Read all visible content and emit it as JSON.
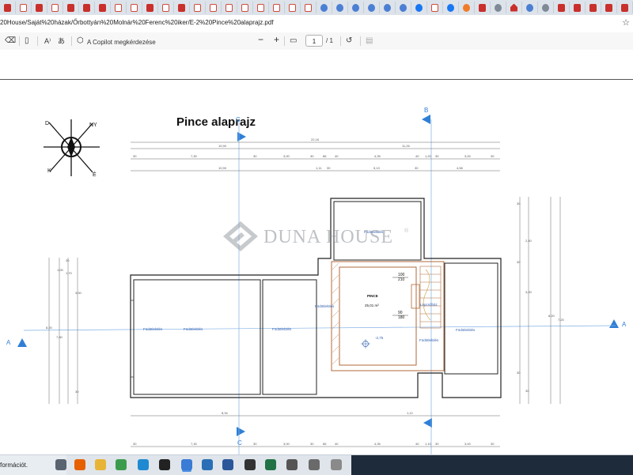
{
  "browser": {
    "tabs": [
      {
        "icon": "pdf-icon"
      },
      {
        "icon": "mail-icon"
      },
      {
        "icon": "pdf-icon"
      },
      {
        "icon": "mail-icon"
      },
      {
        "icon": "pdf-icon"
      },
      {
        "icon": "pdf-icon"
      },
      {
        "icon": "pdf-icon"
      },
      {
        "icon": "mail-icon"
      },
      {
        "icon": "mail-icon"
      },
      {
        "icon": "pdf-icon"
      },
      {
        "icon": "mail-icon"
      },
      {
        "icon": "pdf-icon"
      },
      {
        "icon": "mail-icon"
      },
      {
        "icon": "mail-icon"
      },
      {
        "icon": "mail-icon"
      },
      {
        "icon": "mail-icon"
      },
      {
        "icon": "mail-icon"
      },
      {
        "icon": "mail-icon"
      },
      {
        "icon": "mail-icon"
      },
      {
        "icon": "mail-icon"
      },
      {
        "icon": "search-icon"
      },
      {
        "icon": "search-icon"
      },
      {
        "icon": "search-icon"
      },
      {
        "icon": "search-icon"
      },
      {
        "icon": "search-icon"
      },
      {
        "icon": "search-icon"
      },
      {
        "icon": "facebook-icon"
      },
      {
        "icon": "mail-icon"
      },
      {
        "icon": "facebook-icon"
      },
      {
        "icon": "orange-circle-icon"
      },
      {
        "icon": "pdf-icon"
      },
      {
        "icon": "globe-icon"
      },
      {
        "icon": "home-icon"
      },
      {
        "icon": "search-icon"
      },
      {
        "icon": "help-icon"
      },
      {
        "icon": "pdf-icon"
      },
      {
        "icon": "pdf-icon"
      },
      {
        "icon": "pdf-icon"
      },
      {
        "icon": "pdf-icon"
      },
      {
        "icon": "pdf-icon"
      }
    ],
    "url": "20House/Saját%20házak/Őrbottyán%20Molnár%20Ferenc%20iker/E-2%20Pince%20alaprajz.pdf"
  },
  "pdf_toolbar": {
    "copilot_label": "A Copilot megkérdezése",
    "zoom_out": "−",
    "zoom_in": "+",
    "page_current": "1",
    "page_total": "/ 1"
  },
  "drawing": {
    "title": "Pince alaprajz",
    "watermark": "DUNA HOUSE",
    "watermark_mark": "®",
    "section_labels": {
      "c": "C",
      "b": "B",
      "a": "A"
    },
    "compass": {
      "n": "D",
      "e": "NY",
      "s": "É",
      "w": "K"
    },
    "rooms": {
      "r1": "Födötlelölés",
      "r2": "Födötlelölés",
      "r3": "Födötlelölés",
      "r4": "Födötlelölés",
      "r5": "Födötlelölés",
      "r6": "Födötlelölés",
      "r7": "Födötlelölés",
      "pince": "PINCE",
      "pince_area": "25,01 m²",
      "stair": "Lépcsőház"
    },
    "openings": {
      "a": "100",
      "b": "210",
      "c": "90",
      "d": "180"
    },
    "level": "-2,75",
    "dim_top": {
      "row1": [
        "22,16"
      ],
      "row2": [
        "10,90",
        "11,26"
      ],
      "row3": [
        "30",
        "7,30",
        "30",
        "3,00",
        "30",
        "86",
        "40",
        "4,35",
        "40",
        "1,20",
        "30",
        "3,00",
        "30"
      ],
      "row4": [
        "10,90",
        "1,11",
        "30",
        "5,13",
        "30",
        "4,58"
      ]
    },
    "dim_bottom": {
      "row1": [
        "8,34",
        "1,12"
      ],
      "row2": [
        "30",
        "7,30",
        "30",
        "3,00",
        "30",
        "86",
        "40",
        "4,35",
        "40",
        "1,10",
        "30",
        "3,00",
        "30"
      ]
    },
    "dim_left": [
      "1,00",
      "1,70",
      "3,00",
      "8,20",
      "7,80",
      "30",
      "30"
    ],
    "dim_right": [
      "30",
      "2,40",
      "30",
      "3,00",
      "30",
      "8,20",
      "7,20",
      "30"
    ]
  },
  "taskbar": {
    "text": "formációt.",
    "apps": [
      {
        "icon": "search-icon"
      },
      {
        "icon": "firefox-icon"
      },
      {
        "icon": "file-explorer-icon"
      },
      {
        "icon": "chrome-icon"
      },
      {
        "icon": "edge-icon"
      },
      {
        "icon": "capcut-icon"
      },
      {
        "icon": "paint-icon"
      },
      {
        "icon": "mail-icon"
      },
      {
        "icon": "word-icon"
      },
      {
        "icon": "media-icon"
      },
      {
        "icon": "excel-icon"
      },
      {
        "icon": "photos-icon"
      },
      {
        "icon": "cloud-icon"
      },
      {
        "icon": "notepad-icon"
      }
    ]
  }
}
